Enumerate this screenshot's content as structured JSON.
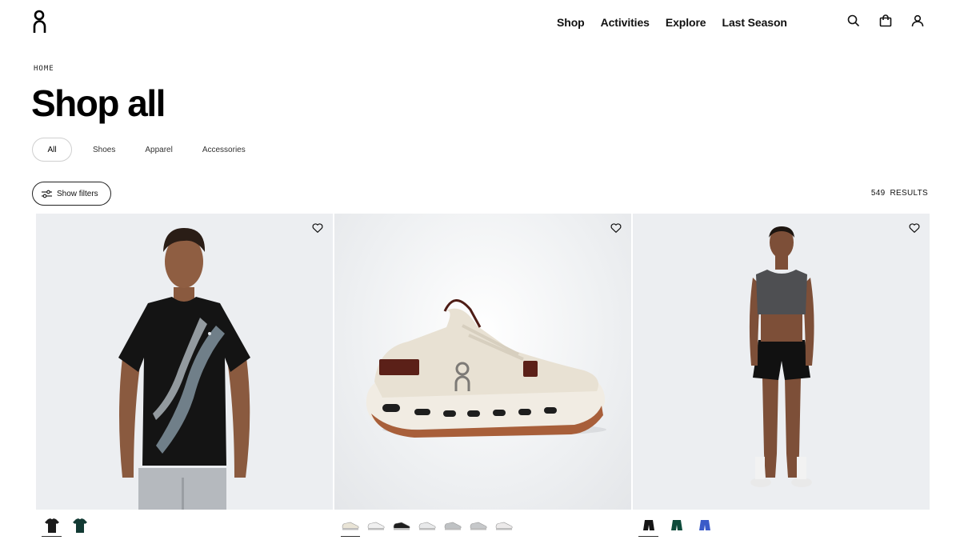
{
  "nav": {
    "items": [
      "Shop",
      "Activities",
      "Explore",
      "Last Season"
    ]
  },
  "breadcrumb": "HOME",
  "page_title": "Shop all",
  "categories": {
    "tabs": [
      "All",
      "Shoes",
      "Apparel",
      "Accessories"
    ],
    "active": "All"
  },
  "filters": {
    "button_label": "Show filters"
  },
  "results": {
    "count": "549",
    "label": "RESULTS"
  },
  "products": [
    {
      "kind": "t-shirt",
      "swatch_colors": [
        "#1b1b1b",
        "#123a33"
      ]
    },
    {
      "kind": "shoe",
      "swatch_colors": [
        "#e9e4d6",
        "#f0f0f0",
        "#1e1e1e",
        "#e8e9ea",
        "#bfc2c4",
        "#c6c8ca",
        "#eceaea"
      ]
    },
    {
      "kind": "activewear",
      "swatch_colors": [
        "#151515",
        "#0d4a3a",
        "#3a5bc8"
      ]
    }
  ],
  "icons": {
    "logo": "on-logo-icon",
    "search": "search-icon",
    "bag": "shopping-bag-icon",
    "account": "account-icon",
    "filters": "sliders-icon",
    "wishlist": "heart-icon"
  }
}
